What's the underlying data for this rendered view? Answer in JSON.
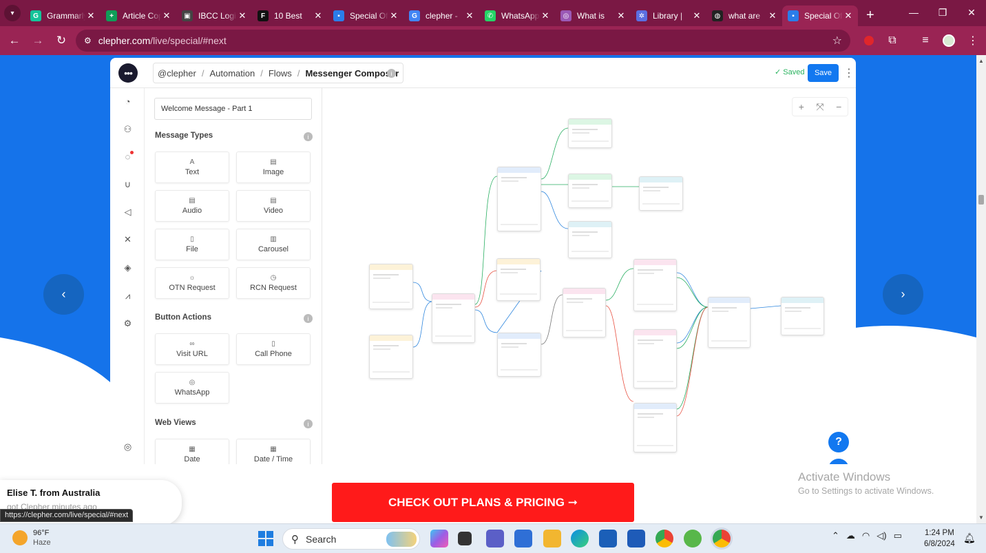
{
  "browser": {
    "tabs": [
      {
        "label": "Grammarly",
        "fav": "G",
        "color": "#15c39a"
      },
      {
        "label": "Article Copy",
        "fav": "+",
        "color": "#0f9d58"
      },
      {
        "label": "IBCC Login",
        "fav": "▣",
        "color": "#444"
      },
      {
        "label": "10 Best",
        "fav": "F",
        "color": "#111"
      },
      {
        "label": "Special Offer",
        "fav": "▪",
        "color": "#2b7de9"
      },
      {
        "label": "clepher -",
        "fav": "G",
        "color": "#4285f4"
      },
      {
        "label": "WhatsApp",
        "fav": "✆",
        "color": "#25d366"
      },
      {
        "label": "What is",
        "fav": "◎",
        "color": "#9b59b6"
      },
      {
        "label": "Library |",
        "fav": "✲",
        "color": "#5b6ee1"
      },
      {
        "label": "what are",
        "fav": "◍",
        "color": "#222"
      },
      {
        "label": "Special Offer",
        "fav": "▪",
        "color": "#2b7de9",
        "active": true
      }
    ],
    "url_host": "clepher.com",
    "url_path": "/live/special/#next",
    "status_url": "https://clepher.com/live/special/#next"
  },
  "app": {
    "breadcrumb": [
      "@clepher",
      "Automation",
      "Flows",
      "Messenger Composer"
    ],
    "saved_label": "Saved",
    "save_label": "Save",
    "flow_name": "Welcome Message - Part 1",
    "sections": {
      "message_types": "Message Types",
      "button_actions": "Button Actions",
      "web_views": "Web Views"
    },
    "message_types": [
      {
        "label": "Text",
        "icon": "text-icon",
        "glyph": "A"
      },
      {
        "label": "Image",
        "icon": "image-icon",
        "glyph": "▤"
      },
      {
        "label": "Audio",
        "icon": "audio-icon",
        "glyph": "▤"
      },
      {
        "label": "Video",
        "icon": "video-icon",
        "glyph": "▤"
      },
      {
        "label": "File",
        "icon": "file-icon",
        "glyph": "▯"
      },
      {
        "label": "Carousel",
        "icon": "carousel-icon",
        "glyph": "▥"
      },
      {
        "label": "OTN Request",
        "icon": "otn-icon",
        "glyph": "☼"
      },
      {
        "label": "RCN Request",
        "icon": "rcn-icon",
        "glyph": "◷"
      }
    ],
    "button_actions": [
      {
        "label": "Visit URL",
        "icon": "link-icon",
        "glyph": "∞"
      },
      {
        "label": "Call Phone",
        "icon": "phone-icon",
        "glyph": "▯"
      },
      {
        "label": "WhatsApp",
        "icon": "whatsapp-icon",
        "glyph": "◎"
      }
    ],
    "web_views": [
      {
        "label": "Date",
        "icon": "calendar-icon",
        "glyph": "▦"
      },
      {
        "label": "Date / Time",
        "icon": "calendar-clock-icon",
        "glyph": "▦"
      }
    ],
    "help_label": "?"
  },
  "page": {
    "cta": "CHECK OUT PLANS & PRICING ➞",
    "toast_name": "Elise T. from Australia",
    "toast_sub": "got Clepher minutes ago",
    "activate_title": "Activate Windows",
    "activate_sub": "Go to Settings to activate Windows."
  },
  "taskbar": {
    "temp": "96°F",
    "weather": "Haze",
    "search": "Search",
    "time": "1:24 PM",
    "date": "6/8/2024"
  }
}
